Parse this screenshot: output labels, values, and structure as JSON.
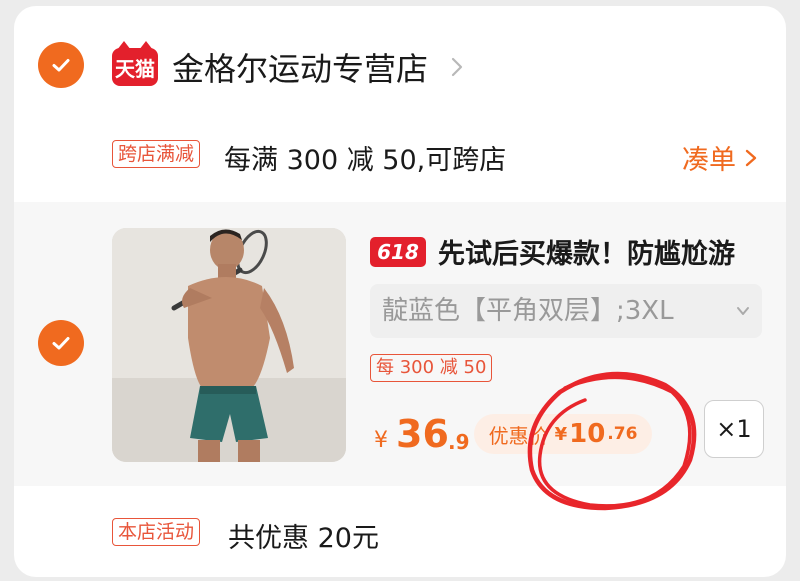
{
  "shop": {
    "platform_badge": "天猫",
    "name": "金格尔运动专营店"
  },
  "promo": {
    "tag": "跨店满减",
    "text": "每满 300 减 50,可跨店",
    "action": "凑单"
  },
  "item": {
    "badge": "618",
    "title": "先试后买爆款！防尴尬游",
    "sku": "靛蓝色【平角双层】;3XL",
    "discount_tag": "每 300 减 50",
    "price_symbol": "¥",
    "price_int": "36",
    "price_dec": ".9",
    "coupon_label": "优惠价",
    "coupon_symbol": "¥",
    "coupon_int": "10",
    "coupon_dec": ".76",
    "quantity": "×1"
  },
  "footer": {
    "tag": "本店活动",
    "text": "共优惠 20元"
  },
  "colors": {
    "accent": "#f06a1f",
    "tmall_red": "#e3202c",
    "annotation_red": "#e8262b"
  },
  "icons": [
    "check-icon",
    "tmall-logo-icon",
    "chevron-right-icon",
    "chevron-down-icon"
  ]
}
